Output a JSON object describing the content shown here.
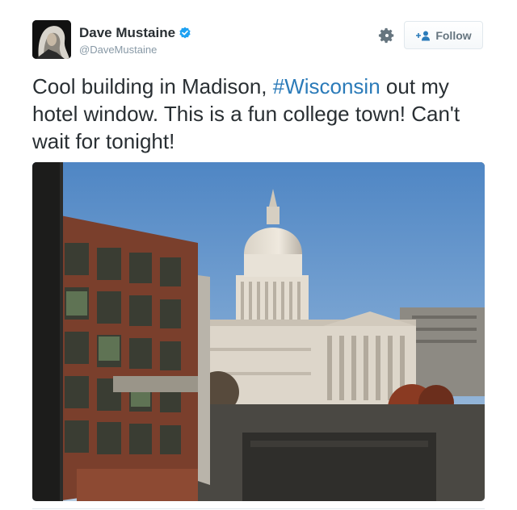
{
  "user": {
    "display_name": "Dave Mustaine",
    "screen_name": "@DaveMustaine",
    "verified": true
  },
  "actions": {
    "follow_label": "Follow"
  },
  "tweet": {
    "text_before": "Cool building in Madison, ",
    "hashtag": "#Wisconsin",
    "text_after": " out my hotel window. This is a fun college town! Can't wait for tonight!"
  },
  "icons": {
    "gear": "gear-icon",
    "verified": "verified-badge-icon",
    "follow": "add-user-icon"
  },
  "colors": {
    "link": "#2b7bb9",
    "verified": "#1da1f2",
    "muted": "#8899a6"
  }
}
